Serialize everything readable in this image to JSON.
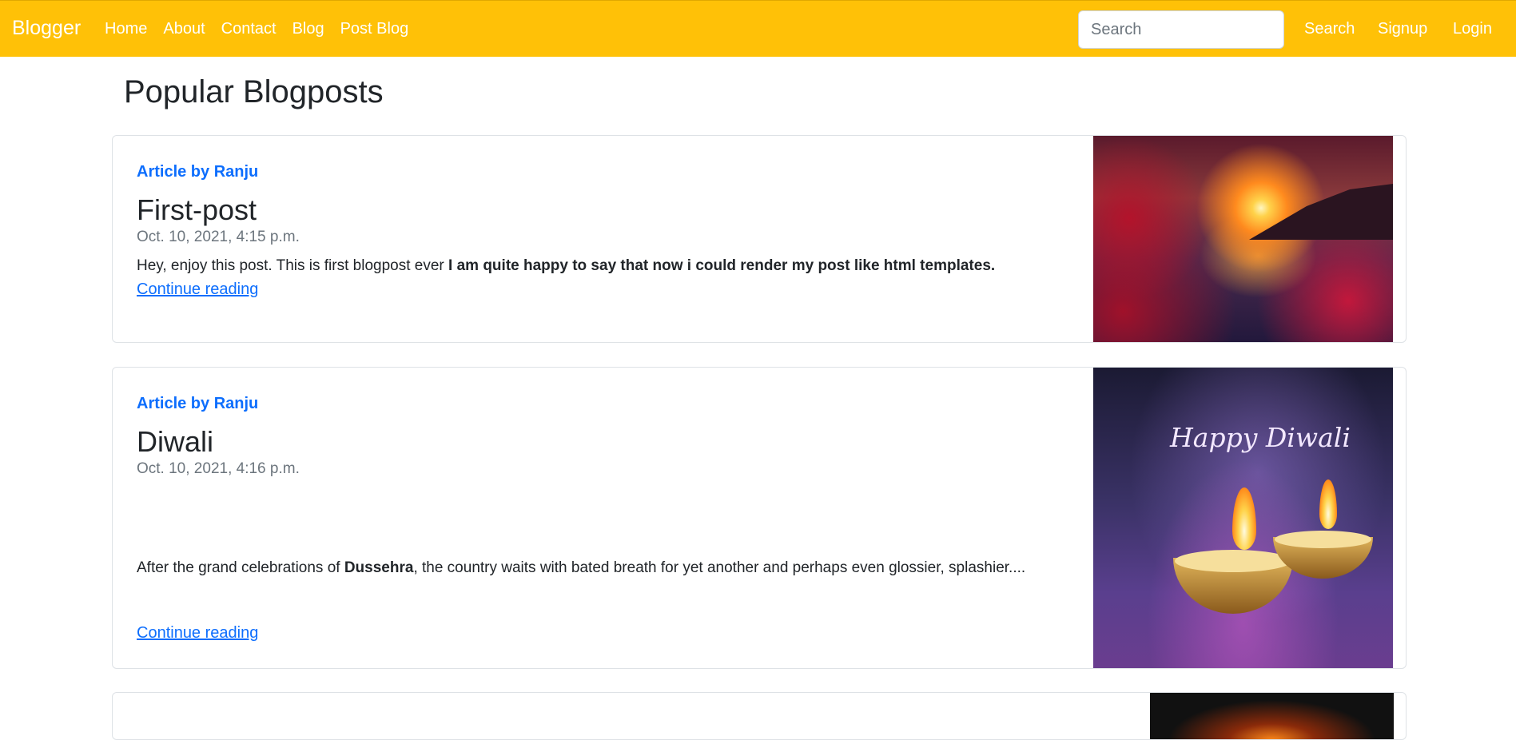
{
  "navbar": {
    "brand": "Blogger",
    "links": [
      "Home",
      "About",
      "Contact",
      "Blog",
      "Post Blog"
    ],
    "search_placeholder": "Search",
    "search_button": "Search",
    "signup": "Signup",
    "login": "Login",
    "background_color": "#ffc107"
  },
  "main": {
    "title": "Popular Blogposts",
    "posts": [
      {
        "author": "Article by Ranju",
        "title": "First-post",
        "date": "Oct. 10, 2021, 4:15 p.m.",
        "text_plain": "Hey, enjoy this post. This is first blogpost ever ",
        "text_bold": "I am quite happy to say that now i could render my post like html templates.",
        "continue": "Continue reading",
        "image": "sunset-lake-image"
      },
      {
        "author": "Article by Ranju",
        "title": "Diwali",
        "date": "Oct. 10, 2021, 4:16 p.m.",
        "text_plain_1": "After the grand celebrations of ",
        "text_bold": "Dussehra",
        "text_plain_2": ", the country waits with bated breath for yet another and perhaps even glossier, splashier....",
        "continue": "Continue reading",
        "image": "happy-diwali-image",
        "image_text": "Happy Diwali"
      },
      {
        "image": "fire-image"
      }
    ]
  },
  "colors": {
    "accent": "#ffc107",
    "link": "#0d6efd",
    "muted": "#6c757d"
  }
}
